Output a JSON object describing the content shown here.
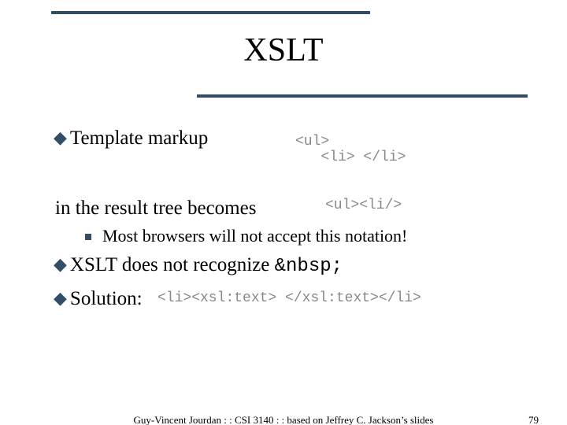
{
  "title": "XSLT",
  "bullets": {
    "b1": "Template markup",
    "code1_line1": "<ul>",
    "code1_line2": "   <li> </li>",
    "line2": "in the result tree becomes",
    "code2": "<ul><li/>",
    "sub1": "Most browsers will not accept this notation!",
    "b3_pre": "XSLT does not recognize ",
    "b3_code": "&nbsp;",
    "b4": "Solution:",
    "code3": "<li><xsl:text> </xsl:text></li>"
  },
  "footer": {
    "center": "Guy-Vincent Jourdan : : CSI 3140 : : based on Jeffrey C. Jackson’s slides",
    "page": "79"
  }
}
